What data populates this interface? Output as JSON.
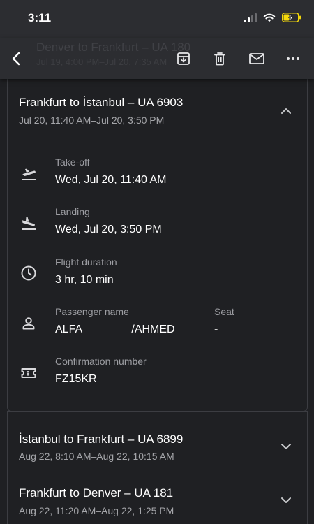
{
  "status_bar": {
    "time": "3:11"
  },
  "header": {
    "ghost_title": "Denver to Frankfurt – UA 180",
    "ghost_subtitle": "Jul 19, 4:00 PM–Jul 20, 7:35 AM",
    "icons": [
      "back-arrow-icon",
      "archive-icon",
      "trash-icon",
      "mail-icon",
      "more-icon"
    ]
  },
  "flights": [
    {
      "title": "Frankfurt to İstanbul – UA 6903",
      "times": "Jul 20, 11:40 AM–Jul 20, 3:50 PM",
      "expanded": true,
      "details": {
        "takeoff_label": "Take-off",
        "takeoff_value": "Wed, Jul 20, 11:40 AM",
        "landing_label": "Landing",
        "landing_value": "Wed, Jul 20, 3:50 PM",
        "duration_label": "Flight duration",
        "duration_value": "3 hr, 10 min",
        "passenger_label": "Passenger name",
        "passenger_value": "ALFA                /AHMED",
        "seat_label": "Seat",
        "seat_value": "-",
        "confirmation_label": "Confirmation number",
        "confirmation_value": "FZ15KR"
      }
    },
    {
      "title": "İstanbul to Frankfurt – UA 6899",
      "times": "Aug 22, 8:10 AM–Aug 22, 10:15 AM",
      "expanded": false
    },
    {
      "title": "Frankfurt to Denver – UA 181",
      "times": "Aug 22, 11:20 AM–Aug 22, 1:25 PM",
      "expanded": false
    }
  ],
  "colors": {
    "background": "#1f2023",
    "app_bar": "#2c2d31",
    "border": "#3c3d42",
    "secondary_text": "#a4a5a9",
    "battery_charging": "#f5d90a"
  }
}
